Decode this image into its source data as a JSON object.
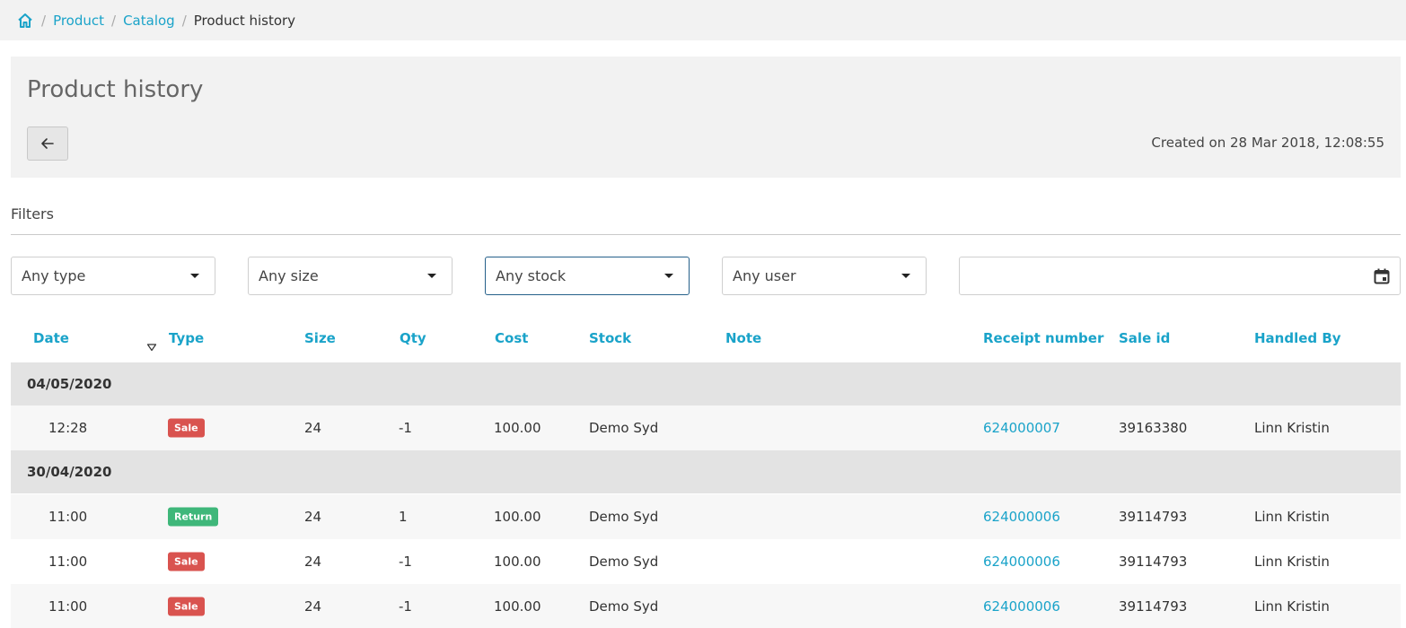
{
  "breadcrumb": {
    "home_icon": "home-icon",
    "items": [
      {
        "label": "Product"
      },
      {
        "label": "Catalog"
      }
    ],
    "current": "Product history",
    "separator": "/"
  },
  "header": {
    "title": "Product history",
    "back_icon": "arrow-left-icon",
    "created": "Created on 28 Mar 2018, 12:08:55"
  },
  "filters": {
    "title": "Filters",
    "type_select": "Any type",
    "size_select": "Any size",
    "stock_select": "Any stock",
    "user_select": "Any user",
    "date_range_value": "",
    "calendar_icon": "calendar-icon"
  },
  "table": {
    "columns": {
      "date": "Date",
      "type": "Type",
      "size": "Size",
      "qty": "Qty",
      "cost": "Cost",
      "stock": "Stock",
      "note": "Note",
      "receipt": "Receipt number",
      "sale_id": "Sale id",
      "handled_by": "Handled By"
    },
    "sort_icon": "sort-descending-icon",
    "groups": [
      {
        "date": "04/05/2020",
        "rows": [
          {
            "time": "12:28",
            "type": "Sale",
            "size": "24",
            "qty": "-1",
            "cost": "100.00",
            "stock": "Demo Syd",
            "note": "",
            "receipt": "624000007",
            "sale_id": "39163380",
            "handled_by": "Linn Kristin"
          }
        ]
      },
      {
        "date": "30/04/2020",
        "rows": [
          {
            "time": "11:00",
            "type": "Return",
            "size": "24",
            "qty": "1",
            "cost": "100.00",
            "stock": "Demo Syd",
            "note": "",
            "receipt": "624000006",
            "sale_id": "39114793",
            "handled_by": "Linn Kristin"
          },
          {
            "time": "11:00",
            "type": "Sale",
            "size": "24",
            "qty": "-1",
            "cost": "100.00",
            "stock": "Demo Syd",
            "note": "",
            "receipt": "624000006",
            "sale_id": "39114793",
            "handled_by": "Linn Kristin"
          },
          {
            "time": "11:00",
            "type": "Sale",
            "size": "24",
            "qty": "-1",
            "cost": "100.00",
            "stock": "Demo Syd",
            "note": "",
            "receipt": "624000006",
            "sale_id": "39114793",
            "handled_by": "Linn Kristin"
          }
        ]
      }
    ]
  },
  "colors": {
    "accent": "#1aa3c9",
    "sale_badge": "#d9534f",
    "return_badge": "#3fb77a"
  }
}
